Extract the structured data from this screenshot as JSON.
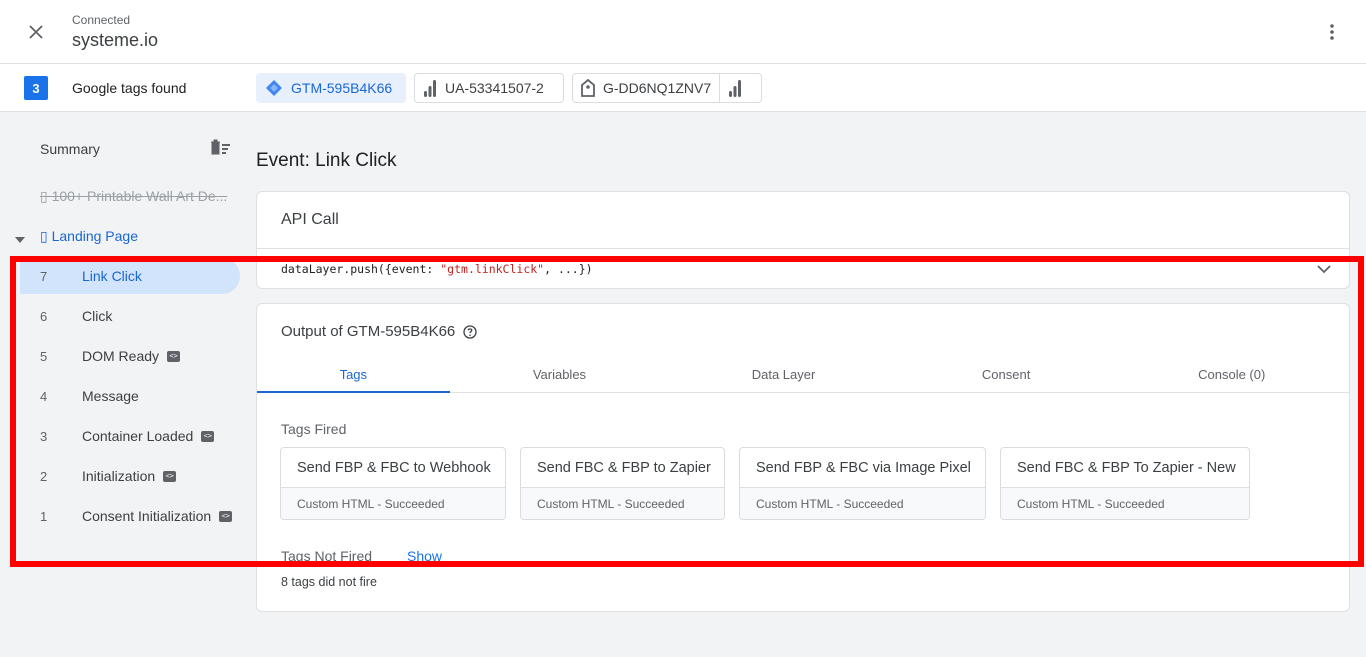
{
  "header": {
    "status": "Connected",
    "site": "systeme.io"
  },
  "tags_bar": {
    "count": "3",
    "label": "Google tags found",
    "chips": [
      {
        "label": "GTM-595B4K66",
        "icon": "gtm-diamond-icon",
        "active": true
      },
      {
        "label": "UA-53341507-2",
        "icon": "analytics-bars-icon",
        "active": false
      },
      {
        "label": "G-DD6NQ1ZNV7",
        "icon": "google-tag-icon",
        "active": false
      }
    ]
  },
  "sidebar": {
    "summary": "Summary",
    "previous_page": "▯ 100+ Printable Wall Art De...",
    "current_page": "▯ Landing Page",
    "events": [
      {
        "num": "7",
        "label": "Link Click",
        "selected": true,
        "code": false
      },
      {
        "num": "6",
        "label": "Click",
        "selected": false,
        "code": false
      },
      {
        "num": "5",
        "label": "DOM Ready",
        "selected": false,
        "code": true
      },
      {
        "num": "4",
        "label": "Message",
        "selected": false,
        "code": false
      },
      {
        "num": "3",
        "label": "Container Loaded",
        "selected": false,
        "code": true
      },
      {
        "num": "2",
        "label": "Initialization",
        "selected": false,
        "code": true
      },
      {
        "num": "1",
        "label": "Consent Initialization",
        "selected": false,
        "code": true
      }
    ]
  },
  "main": {
    "event_title": "Event: Link Click",
    "api_card": {
      "title": "API Call",
      "code_prefix": "dataLayer.push({event: ",
      "code_string": "\"gtm.linkClick\"",
      "code_suffix": ", ...})"
    },
    "output": {
      "title": "Output of GTM-595B4K66",
      "tabs": [
        "Tags",
        "Variables",
        "Data Layer",
        "Consent",
        "Console (0)"
      ],
      "active_tab": "Tags",
      "fired_label": "Tags Fired",
      "fired_tags": [
        {
          "name": "Send FBP & FBC to Webhook",
          "status": "Custom HTML - Succeeded"
        },
        {
          "name": "Send FBC & FBP to Zapier",
          "status": "Custom HTML - Succeeded"
        },
        {
          "name": "Send FBP & FBC via Image Pixel",
          "status": "Custom HTML - Succeeded"
        },
        {
          "name": "Send FBC & FBP To Zapier - New",
          "status": "Custom HTML - Succeeded"
        }
      ],
      "not_fired_label": "Tags Not Fired",
      "show_label": "Show",
      "not_fired_count": "8 tags did not fire"
    }
  },
  "colors": {
    "accent": "#1a73e8",
    "selected_bg": "#d2e3fc",
    "highlight": "#ff0000"
  }
}
